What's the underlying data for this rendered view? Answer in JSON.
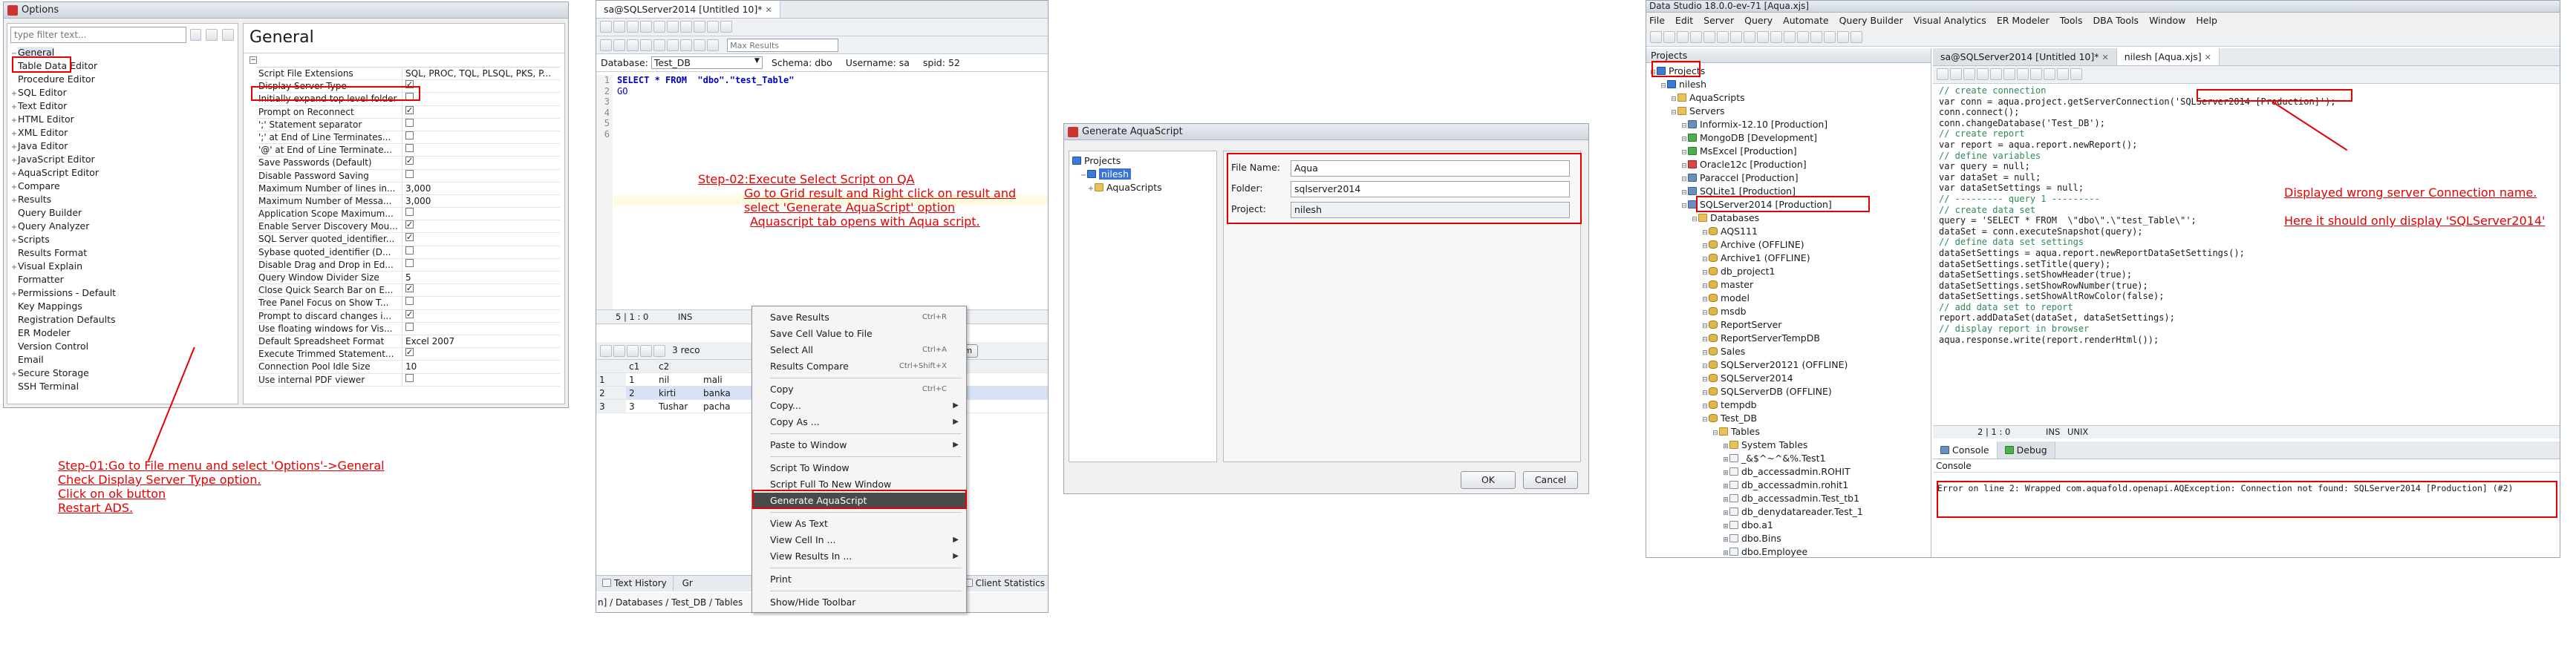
{
  "options_window": {
    "title": "Options",
    "filter_placeholder": "type filter text...",
    "section_title": "General",
    "tree": [
      {
        "label": "General",
        "expanded": true
      },
      {
        "label": "Table Data Editor"
      },
      {
        "label": "Procedure Editor"
      },
      {
        "label": "SQL Editor",
        "expandable": true
      },
      {
        "label": "Text Editor",
        "expandable": true
      },
      {
        "label": "HTML Editor",
        "expandable": true
      },
      {
        "label": "XML Editor",
        "expandable": true
      },
      {
        "label": "Java Editor",
        "expandable": true
      },
      {
        "label": "JavaScript Editor",
        "expandable": true
      },
      {
        "label": "AquaScript Editor",
        "expandable": true
      },
      {
        "label": "Compare",
        "expandable": true
      },
      {
        "label": "Results",
        "expandable": true
      },
      {
        "label": "Query Builder"
      },
      {
        "label": "Query Analyzer",
        "expandable": true
      },
      {
        "label": "Scripts",
        "expandable": true
      },
      {
        "label": "Results Format"
      },
      {
        "label": "Visual Explain",
        "expandable": true
      },
      {
        "label": "Formatter"
      },
      {
        "label": "Permissions - Default",
        "expandable": true
      },
      {
        "label": "Key Mappings"
      },
      {
        "label": "Registration Defaults"
      },
      {
        "label": "ER Modeler"
      },
      {
        "label": "Version Control"
      },
      {
        "label": "Email"
      },
      {
        "label": "Secure Storage",
        "expandable": true
      },
      {
        "label": "SSH Terminal"
      }
    ],
    "settings": [
      {
        "name": "Script File Extensions",
        "value": "SQL, PROC, TQL, PLSQL, PKS, P...",
        "type": "text"
      },
      {
        "name": "Display Server Type",
        "value": "",
        "type": "check",
        "checked": true
      },
      {
        "name": "Initially expand top level folder",
        "type": "check",
        "checked": false
      },
      {
        "name": "Prompt on Reconnect",
        "type": "check",
        "checked": true
      },
      {
        "name": "';' Statement separator",
        "type": "check",
        "checked": false
      },
      {
        "name": "';' at End of Line Terminates...",
        "type": "check",
        "checked": false
      },
      {
        "name": "'@' at End of Line Terminate...",
        "type": "check",
        "checked": false
      },
      {
        "name": "Save Passwords (Default)",
        "type": "check",
        "checked": true
      },
      {
        "name": "Disable Password Saving",
        "type": "check",
        "checked": false
      },
      {
        "name": "Maximum Number of lines in...",
        "value": "3,000",
        "type": "text"
      },
      {
        "name": "Maximum Number of Messa...",
        "value": "3,000",
        "type": "text"
      },
      {
        "name": "Application Scope Maximum...",
        "type": "check",
        "checked": false
      },
      {
        "name": "Enable Server Discovery Mou...",
        "type": "check",
        "checked": true
      },
      {
        "name": "SQL Server quoted_identifier...",
        "type": "check",
        "checked": true
      },
      {
        "name": "Sybase quoted_identifier (D...",
        "type": "check",
        "checked": false
      },
      {
        "name": "Disable Drag and Drop in Ed...",
        "type": "check",
        "checked": false
      },
      {
        "name": "Query Window Divider Size",
        "value": "5",
        "type": "text"
      },
      {
        "name": "Close Quick Search Bar on E...",
        "type": "check",
        "checked": true
      },
      {
        "name": "Tree Panel Focus on Show T...",
        "type": "check",
        "checked": false
      },
      {
        "name": "Prompt to discard changes i...",
        "type": "check",
        "checked": true
      },
      {
        "name": "Use floating windows for Vis...",
        "type": "check",
        "checked": false
      },
      {
        "name": "Default Spreadsheet Format",
        "value": "Excel 2007",
        "type": "text"
      },
      {
        "name": "Execute Trimmed Statement...",
        "type": "check",
        "checked": true
      },
      {
        "name": "Connection Pool Idle Size",
        "value": "10",
        "type": "text"
      },
      {
        "name": "Use internal PDF viewer",
        "type": "check",
        "checked": false
      }
    ]
  },
  "step01": {
    "lines": [
      "Step-01:Go to File menu and select 'Options'->General",
      "Check Display Server Type option.",
      "Click on ok button",
      "Restart ADS."
    ]
  },
  "query_window": {
    "tab_title": "sa@SQLServer2014 [Untitled 10]*",
    "max_results_placeholder": "Max Results",
    "database_label": "Database:",
    "database_value": "Test_DB",
    "schema_label": "Schema:",
    "schema_value": "dbo",
    "username_label": "Username:",
    "username_value": "sa",
    "spid_label": "spid:",
    "spid_value": "52",
    "code_lines": [
      "SELECT * FROM  \"dbo\".\"test_Table\"",
      "GO",
      "",
      "",
      "",
      ""
    ],
    "line_numbers": [
      "1",
      "2",
      "3",
      "4",
      "5",
      "6"
    ],
    "status_pos": "5 | 1 : 0",
    "status_ins": "INS",
    "grid_info": "3 reco",
    "sum_label": "Sum",
    "grid_headers": [
      "",
      "c1",
      "c2"
    ],
    "grid_rows": [
      [
        "1",
        "1",
        "nil",
        "mali"
      ],
      [
        "2",
        "2",
        "kirti",
        "banka"
      ],
      [
        "3",
        "3",
        "Tushar",
        "pacha"
      ]
    ],
    "bottom_tabs": [
      "Text History",
      "Gr"
    ],
    "client_stats": "Client Statistics",
    "breadcrumb": "n] / Databases / Test_DB / Tables"
  },
  "step02": {
    "lines": [
      "Step-02:Execute Select Script on QA",
      "Go to Grid result and Right click on result and",
      "select 'Generate AquaScript' option",
      "Aquascript tab opens with Aqua script."
    ]
  },
  "context_menu": {
    "items": [
      {
        "label": "Save Results",
        "shortcut": "Ctrl+R"
      },
      {
        "label": "Save Cell Value to File"
      },
      {
        "label": "Select All",
        "shortcut": "Ctrl+A"
      },
      {
        "label": "Results Compare",
        "shortcut": "Ctrl+Shift+X"
      },
      {
        "sep": true
      },
      {
        "label": "Copy",
        "shortcut": "Ctrl+C"
      },
      {
        "label": "Copy...",
        "submenu": true
      },
      {
        "label": "Copy As ...",
        "submenu": true
      },
      {
        "sep": true
      },
      {
        "label": "Paste to Window",
        "submenu": true
      },
      {
        "sep": true
      },
      {
        "label": "Script To Window"
      },
      {
        "label": "Script Full To New Window"
      },
      {
        "label": "Generate AquaScript",
        "highlight": true
      },
      {
        "sep": true
      },
      {
        "label": "View As Text"
      },
      {
        "label": "View Cell In ...",
        "submenu": true
      },
      {
        "label": "View Results In ...",
        "submenu": true
      },
      {
        "sep": true
      },
      {
        "label": "Print"
      },
      {
        "sep": true
      },
      {
        "label": "Show/Hide Toolbar"
      }
    ]
  },
  "generate_dialog": {
    "title": "Generate AquaScript",
    "tree": [
      "Projects",
      "nilesh",
      "AquaScripts"
    ],
    "file_name_label": "File Name:",
    "file_name_value": "Aqua",
    "folder_label": "Folder:",
    "folder_value": "sqlserver2014",
    "project_label": "Project:",
    "project_value": "nilesh",
    "ok_label": "OK",
    "cancel_label": "Cancel"
  },
  "ads_window": {
    "title": "Data Studio 18.0.0-ev-71 [Aqua.xjs]",
    "menu": [
      "File",
      "Edit",
      "Server",
      "Query",
      "Automate",
      "Query Builder",
      "Visual Analytics",
      "ER Modeler",
      "Tools",
      "DBA Tools",
      "Window",
      "Help"
    ],
    "projects_panel_title": "Projects",
    "tree": [
      {
        "label": "Projects",
        "depth": 0,
        "icon": "proj"
      },
      {
        "label": "nilesh",
        "depth": 1,
        "icon": "proj"
      },
      {
        "label": "AquaScripts",
        "depth": 2,
        "icon": "folder"
      },
      {
        "label": "Servers",
        "depth": 2,
        "icon": "folder"
      },
      {
        "label": "Informix-12.10 [Production]",
        "depth": 3,
        "icon": "server"
      },
      {
        "label": "MongoDB [Development]",
        "depth": 3,
        "icon": "green"
      },
      {
        "label": "MsExcel [Production]",
        "depth": 3,
        "icon": "green"
      },
      {
        "label": "Oracle12c [Production]",
        "depth": 3,
        "icon": "red"
      },
      {
        "label": "Paraccel [Production]",
        "depth": 3,
        "icon": "server"
      },
      {
        "label": "SQLite1 [Production]",
        "depth": 3,
        "icon": "server"
      },
      {
        "label": "SQLServer2014 [Production]",
        "depth": 3,
        "icon": "server"
      },
      {
        "label": "Databases",
        "depth": 4,
        "icon": "folder"
      },
      {
        "label": "AQS111",
        "depth": 5,
        "icon": "db"
      },
      {
        "label": "Archive (OFFLINE)",
        "depth": 5,
        "icon": "db"
      },
      {
        "label": "Archive1 (OFFLINE)",
        "depth": 5,
        "icon": "db"
      },
      {
        "label": "db_project1",
        "depth": 5,
        "icon": "db"
      },
      {
        "label": "master",
        "depth": 5,
        "icon": "db"
      },
      {
        "label": "model",
        "depth": 5,
        "icon": "db"
      },
      {
        "label": "msdb",
        "depth": 5,
        "icon": "db"
      },
      {
        "label": "ReportServer",
        "depth": 5,
        "icon": "db"
      },
      {
        "label": "ReportServerTempDB",
        "depth": 5,
        "icon": "db"
      },
      {
        "label": "Sales",
        "depth": 5,
        "icon": "db"
      },
      {
        "label": "SQLServer20121 (OFFLINE)",
        "depth": 5,
        "icon": "db"
      },
      {
        "label": "SQLServer2014",
        "depth": 5,
        "icon": "db"
      },
      {
        "label": "SQLServerDB (OFFLINE)",
        "depth": 5,
        "icon": "db"
      },
      {
        "label": "tempdb",
        "depth": 5,
        "icon": "db"
      },
      {
        "label": "Test_DB",
        "depth": 5,
        "icon": "db"
      },
      {
        "label": "Tables",
        "depth": 6,
        "icon": "folder"
      },
      {
        "label": "System Tables",
        "depth": 7,
        "icon": "folder"
      },
      {
        "label": "_&$^~^&%.Test1",
        "depth": 7,
        "icon": "table"
      },
      {
        "label": "db_accessadmin.ROHIT",
        "depth": 7,
        "icon": "table"
      },
      {
        "label": "db_accessadmin.rohit1",
        "depth": 7,
        "icon": "table"
      },
      {
        "label": "db_accessadmin.Test_tb1",
        "depth": 7,
        "icon": "table"
      },
      {
        "label": "db_denydatareader.Test_1",
        "depth": 7,
        "icon": "table"
      },
      {
        "label": "dbo.a1",
        "depth": 7,
        "icon": "table"
      },
      {
        "label": "dbo.Bins",
        "depth": 7,
        "icon": "table"
      },
      {
        "label": "dbo.Employee",
        "depth": 7,
        "icon": "table"
      }
    ],
    "tabs": [
      "sa@SQLServer2014 [Untitled 10]*",
      "nilesh [Aqua.xjs]"
    ],
    "code_lines": [
      {
        "t": "// create connection",
        "c": "cm"
      },
      {
        "t": "var conn = aqua.project.getServerConnection('SQLServer2014 [Production]');",
        "c": "code"
      },
      {
        "t": "conn.connect();",
        "c": "code"
      },
      {
        "t": "conn.changeDatabase('Test_DB');",
        "c": "code"
      },
      {
        "t": "",
        "c": "code"
      },
      {
        "t": "// create report",
        "c": "cm"
      },
      {
        "t": "var report = aqua.report.newReport();",
        "c": "code"
      },
      {
        "t": "",
        "c": "code"
      },
      {
        "t": "// define variables",
        "c": "cm"
      },
      {
        "t": "var query = null;",
        "c": "code"
      },
      {
        "t": "var dataSet = null;",
        "c": "code"
      },
      {
        "t": "var dataSetSettings = null;",
        "c": "code"
      },
      {
        "t": "",
        "c": "code"
      },
      {
        "t": "// --------- query 1 ---------",
        "c": "cm"
      },
      {
        "t": "// create data set",
        "c": "cm"
      },
      {
        "t": "query = 'SELECT * FROM  \\\"dbo\\\".\\\"test_Table\\\"';",
        "c": "code"
      },
      {
        "t": "dataSet = conn.executeSnapshot(query);",
        "c": "code"
      },
      {
        "t": "",
        "c": "code"
      },
      {
        "t": "// define data set settings",
        "c": "cm"
      },
      {
        "t": "dataSetSettings = aqua.report.newReportDataSetSettings();",
        "c": "code"
      },
      {
        "t": "dataSetSettings.setTitle(query);",
        "c": "code"
      },
      {
        "t": "dataSetSettings.setShowHeader(true);",
        "c": "code"
      },
      {
        "t": "dataSetSettings.setShowRowNumber(true);",
        "c": "code"
      },
      {
        "t": "dataSetSettings.setShowAltRowColor(false);",
        "c": "code"
      },
      {
        "t": "",
        "c": "code"
      },
      {
        "t": "// add data set to report",
        "c": "cm"
      },
      {
        "t": "report.addDataSet(dataSet, dataSetSettings);",
        "c": "code"
      },
      {
        "t": "",
        "c": "code"
      },
      {
        "t": "// display report in browser",
        "c": "cm"
      },
      {
        "t": "aqua.response.write(report.renderHtml());",
        "c": "code"
      }
    ],
    "status_pos": "2 | 1 : 0",
    "status_ins": "INS",
    "status_unix": "UNIX",
    "bottom_tabs": [
      "Console",
      "Debug"
    ],
    "console_label": "Console",
    "console_error": "Error on line 2: Wrapped com.aquafold.openapi.AQException: Connection not found: SQLServer2014 [Production] (#2)"
  },
  "annotation_right": {
    "line1": "Displayed wrong server Connection name.",
    "line2": "Here it should  only display 'SQLServer2014'"
  }
}
